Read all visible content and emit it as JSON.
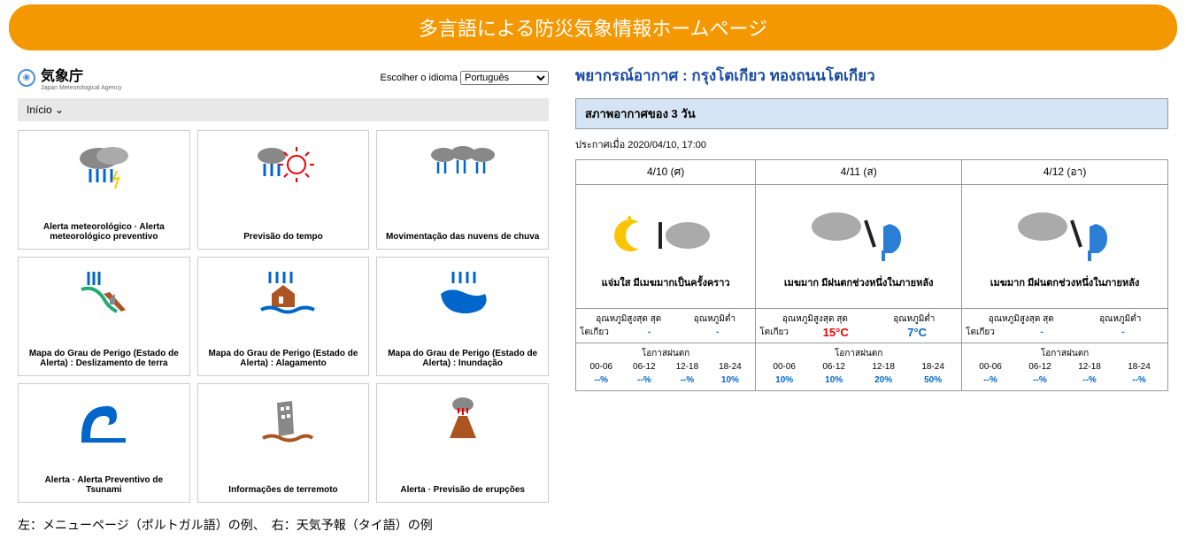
{
  "banner": "多言語による防災気象情報ホームページ",
  "jma": {
    "title": "気象庁",
    "sub": "Japan Meteorological Agency",
    "lang_label": "Escolher o idioma",
    "lang_value": "Português",
    "nav": "Início"
  },
  "tiles": [
    {
      "label": "Alerta meteorológico · Alerta meteorológico preventivo"
    },
    {
      "label": "Previsão do tempo"
    },
    {
      "label": "Movimentação das nuvens de chuva"
    },
    {
      "label": "Mapa do Grau de Perigo (Estado de Alerta) : Deslizamento de terra"
    },
    {
      "label": "Mapa do Grau de Perigo (Estado de Alerta) : Alagamento"
    },
    {
      "label": "Mapa do Grau de Perigo (Estado de Alerta) : Inundação"
    },
    {
      "label": "Alerta · Alerta Preventivo de Tsunami"
    },
    {
      "label": "Informações de terremoto"
    },
    {
      "label": "Alerta · Previsão de erupções"
    }
  ],
  "forecast": {
    "title": "พยากรณ์อากาศ : กรุงโตเกียว ทองถนนโตเกียว",
    "subtitle": "สภาพอากาศของ 3 วัน",
    "issued": "ประกาศเมื่อ 2020/04/10, 17:00",
    "city": "โตเกียว",
    "hi_label": "อุณหภูมิสูงสุด สุด",
    "lo_label": "อุณหภูมิต่ำ",
    "pop_label": "โอกาสฝนตก",
    "slots": [
      "00-06",
      "06-12",
      "12-18",
      "18-24"
    ],
    "days": [
      {
        "date": "4/10 (ศ)",
        "desc": "แจ่มใส มีเมฆมากเป็นครั้งคราว",
        "hi": "-",
        "lo": "-",
        "pop": [
          "--%",
          "--%",
          "--%",
          "10%"
        ]
      },
      {
        "date": "4/11 (ส)",
        "desc": "เมฆมาก มีฝนตกช่วงหนึ่งในภายหลัง",
        "hi": "15°C",
        "lo": "7°C",
        "pop": [
          "10%",
          "10%",
          "20%",
          "50%"
        ]
      },
      {
        "date": "4/12 (อา)",
        "desc": "เมฆมาก มีฝนตกช่วงหนึ่งในภายหลัง",
        "hi": "-",
        "lo": "-",
        "pop": [
          "--%",
          "--%",
          "--%",
          "--%"
        ]
      }
    ]
  },
  "caption": "左：メニューページ（ポルトガル語）の例、　右：天気予報（タイ語）の例"
}
